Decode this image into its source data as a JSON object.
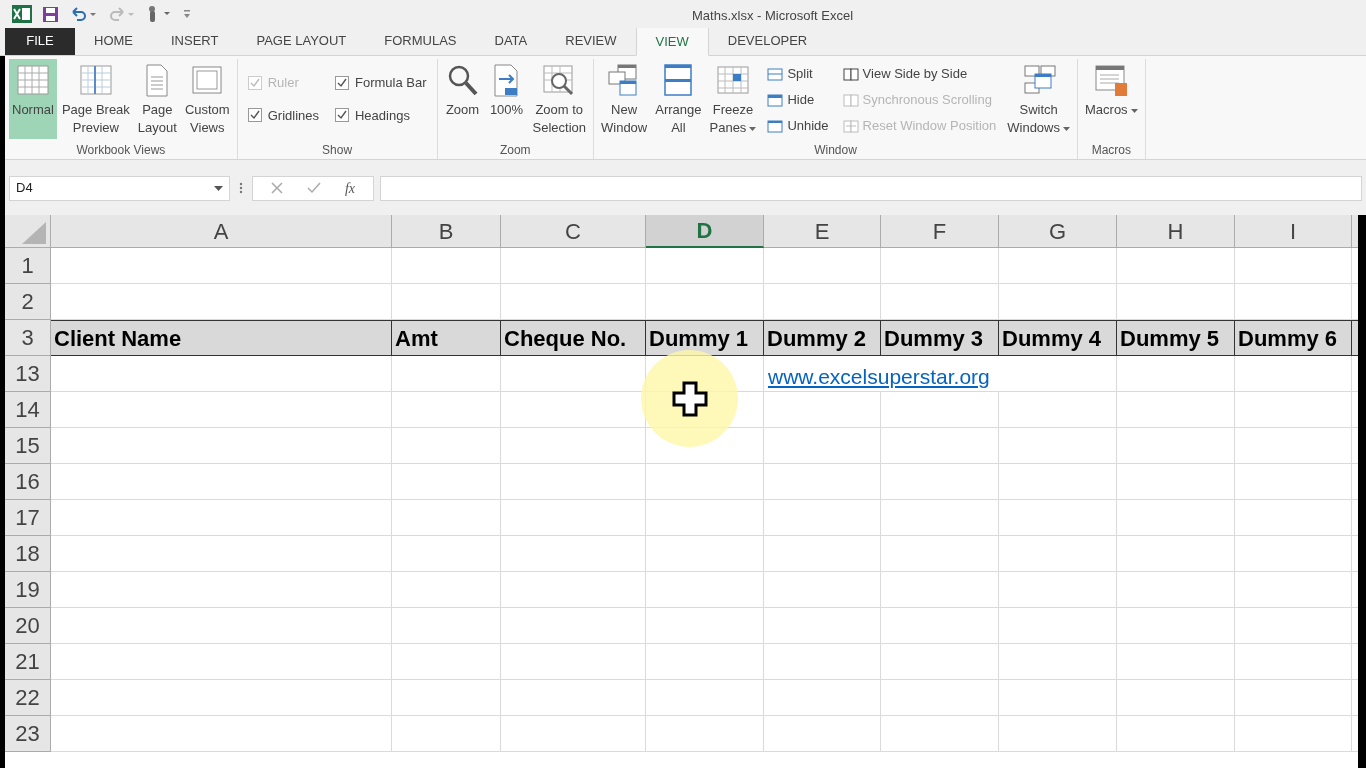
{
  "window": {
    "title": "Maths.xlsx - Microsoft Excel"
  },
  "ribbon_tabs": [
    {
      "label": "FILE",
      "kind": "file",
      "selected": false
    },
    {
      "label": "HOME",
      "kind": "tab",
      "selected": false
    },
    {
      "label": "INSERT",
      "kind": "tab",
      "selected": false
    },
    {
      "label": "PAGE LAYOUT",
      "kind": "tab",
      "selected": false
    },
    {
      "label": "FORMULAS",
      "kind": "tab",
      "selected": false
    },
    {
      "label": "DATA",
      "kind": "tab",
      "selected": false
    },
    {
      "label": "REVIEW",
      "kind": "tab",
      "selected": false
    },
    {
      "label": "VIEW",
      "kind": "tab",
      "selected": true
    },
    {
      "label": "DEVELOPER",
      "kind": "tab",
      "selected": false
    }
  ],
  "ribbon_groups": [
    {
      "label": "Workbook Views",
      "items": [
        {
          "kind": "large",
          "label": "Normal",
          "selected": true
        },
        {
          "kind": "large",
          "label": "Page Break\nPreview",
          "selected": false
        },
        {
          "kind": "large",
          "label": "Page\nLayout",
          "selected": false
        },
        {
          "kind": "large",
          "label": "Custom\nViews",
          "selected": false
        }
      ]
    },
    {
      "label": "Show",
      "items": [
        {
          "kind": "check",
          "label": "Ruler",
          "checked": true,
          "disabled": true
        },
        {
          "kind": "check",
          "label": "Gridlines",
          "checked": true,
          "disabled": false
        },
        {
          "kind": "check",
          "label": "Formula Bar",
          "checked": true,
          "disabled": false
        },
        {
          "kind": "check",
          "label": "Headings",
          "checked": true,
          "disabled": false
        }
      ]
    },
    {
      "label": "Zoom",
      "items": [
        {
          "kind": "large",
          "label": "Zoom",
          "selected": false
        },
        {
          "kind": "large",
          "label": "100%",
          "selected": false
        },
        {
          "kind": "large",
          "label": "Zoom to\nSelection",
          "selected": false
        }
      ]
    },
    {
      "label": "Window",
      "items": [
        {
          "kind": "large",
          "label": "New\nWindow",
          "selected": false
        },
        {
          "kind": "large",
          "label": "Arrange\nAll",
          "selected": false
        },
        {
          "kind": "large",
          "label": "Freeze\nPanes",
          "selected": false,
          "dropdown": true
        },
        {
          "kind": "small",
          "label": "Split",
          "disabled": false
        },
        {
          "kind": "small",
          "label": "Hide",
          "disabled": false
        },
        {
          "kind": "small",
          "label": "Unhide",
          "disabled": false
        },
        {
          "kind": "small",
          "label": "View Side by Side",
          "disabled": false
        },
        {
          "kind": "small",
          "label": "Synchronous Scrolling",
          "disabled": true
        },
        {
          "kind": "small",
          "label": "Reset Window Position",
          "disabled": true
        },
        {
          "kind": "large",
          "label": "Switch\nWindows",
          "selected": false,
          "dropdown": true
        }
      ]
    },
    {
      "label": "Macros",
      "items": [
        {
          "kind": "large",
          "label": "Macros",
          "selected": false,
          "dropdown": true
        }
      ]
    }
  ],
  "formula_bar": {
    "name_box": "D4",
    "function_label": "fx"
  },
  "sheet": {
    "columns": [
      {
        "label": "A",
        "selected": false
      },
      {
        "label": "B",
        "selected": false
      },
      {
        "label": "C",
        "selected": false
      },
      {
        "label": "D",
        "selected": true
      },
      {
        "label": "E",
        "selected": false
      },
      {
        "label": "F",
        "selected": false
      },
      {
        "label": "G",
        "selected": false
      },
      {
        "label": "H",
        "selected": false
      },
      {
        "label": "I",
        "selected": false
      }
    ],
    "rows": [
      {
        "number": "1",
        "kind": "plain"
      },
      {
        "number": "2",
        "kind": "plain"
      },
      {
        "number": "3",
        "kind": "header",
        "cells": [
          "Client Name",
          "Amt",
          "Cheque No.",
          "Dummy 1",
          "Dummy 2",
          "Dummy 3",
          "Dummy 4",
          "Dummy 5",
          "Dummy 6"
        ]
      },
      {
        "number": "13",
        "kind": "plain",
        "link": {
          "text": "www.excelsuperstar.org"
        }
      },
      {
        "number": "14",
        "kind": "plain"
      },
      {
        "number": "15",
        "kind": "plain"
      },
      {
        "number": "16",
        "kind": "plain"
      },
      {
        "number": "17",
        "kind": "plain"
      },
      {
        "number": "18",
        "kind": "plain"
      },
      {
        "number": "19",
        "kind": "plain"
      },
      {
        "number": "20",
        "kind": "plain"
      },
      {
        "number": "21",
        "kind": "plain"
      },
      {
        "number": "22",
        "kind": "plain"
      },
      {
        "number": "23",
        "kind": "plain"
      }
    ]
  }
}
